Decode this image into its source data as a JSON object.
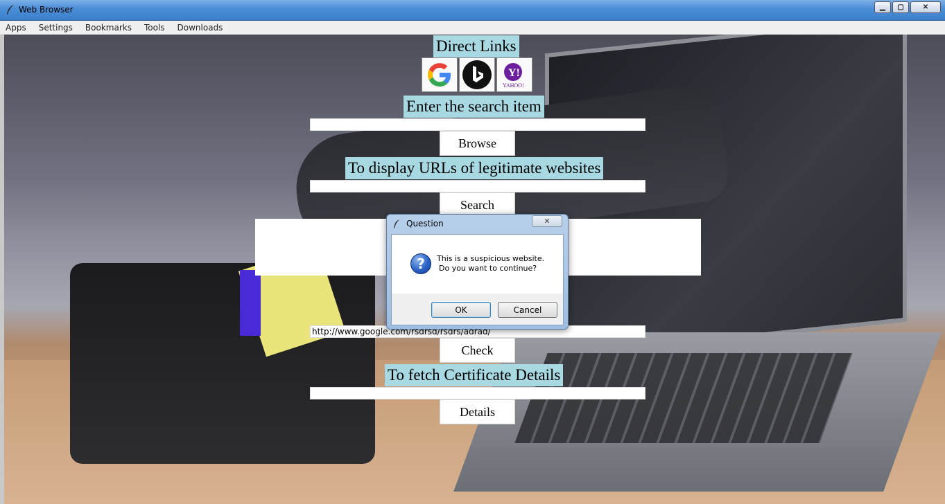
{
  "window": {
    "title": "Web Browser",
    "icon": "feather-icon",
    "controls": [
      "minimize-icon",
      "maximize-icon",
      "close-icon"
    ]
  },
  "menu": {
    "items": [
      "Apps",
      "Settings",
      "Bookmarks",
      "Tools",
      "Downloads"
    ]
  },
  "main": {
    "direct_links_label": "Direct Links",
    "link_buttons": [
      "google-icon",
      "bing-icon",
      "yahoo-icon"
    ],
    "yahoo_text": "Y!",
    "yahoo_caption": "YAHOO!",
    "search_label": "Enter the search item",
    "search_value": "",
    "browse_label": "Browse",
    "legit_label": "To display URLs of legitimate websites",
    "legit_value": "",
    "search_button_label": "Search",
    "url_value": "http://www.google.com/rsdrsd/rsdrs/adrad/",
    "check_label": "Check",
    "cert_label": "To fetch Certificate Details",
    "cert_value": "",
    "details_label": "Details"
  },
  "dialog": {
    "title": "Question",
    "icon": "question-icon",
    "message_line1": "This is a suspicious website.",
    "message_line2": "Do you want to continue?",
    "ok_label": "OK",
    "cancel_label": "Cancel",
    "close_glyph": "✕"
  },
  "colors": {
    "label_bg": "#a8d8e2",
    "titlebar": "#4d8fd7"
  }
}
